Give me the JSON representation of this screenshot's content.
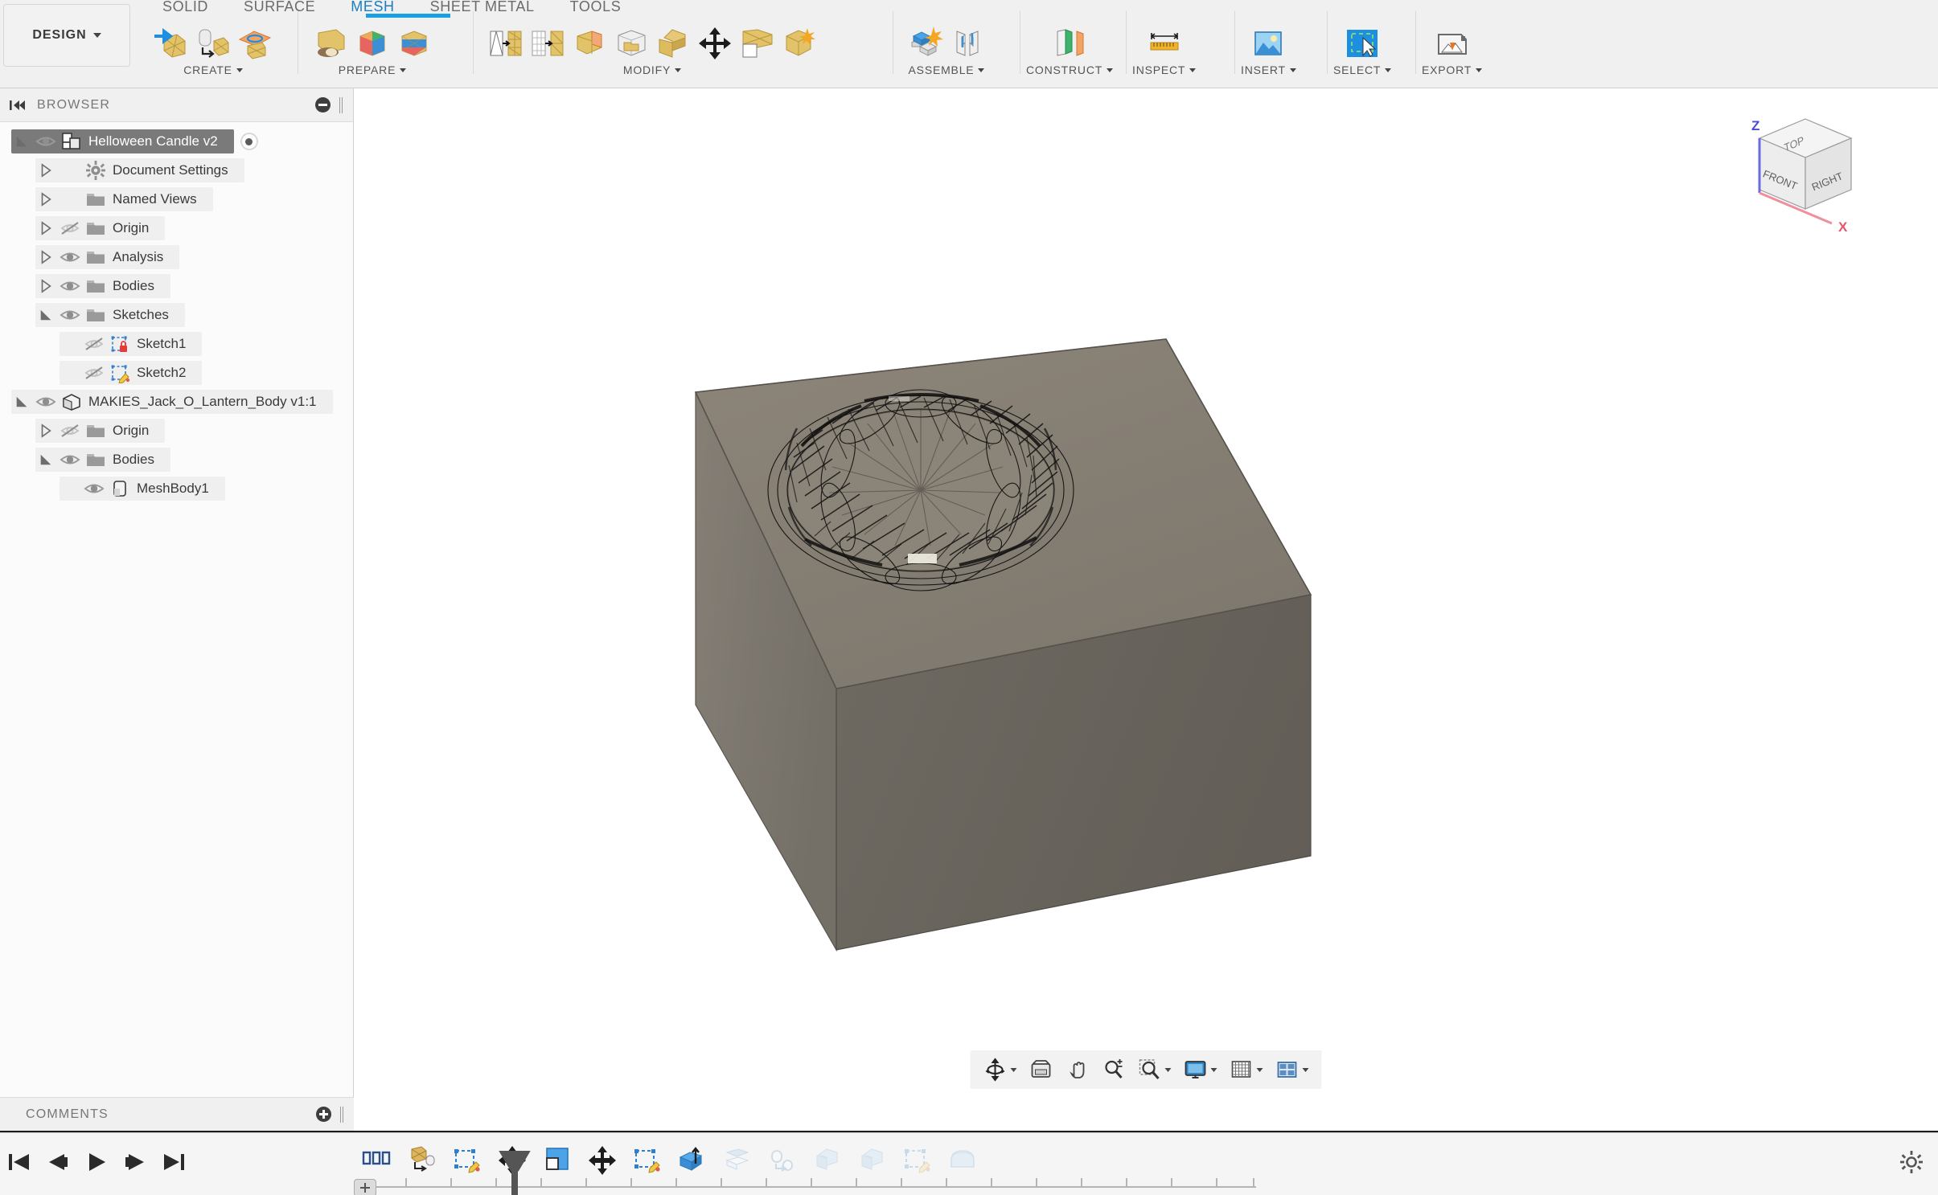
{
  "app": {
    "workspace_button": "DESIGN",
    "accent_color": "#1aa0e0",
    "selection_color": "#7a7a7a"
  },
  "ribbon": {
    "tabs": [
      {
        "label": "SOLID",
        "active": false
      },
      {
        "label": "SURFACE",
        "active": false
      },
      {
        "label": "MESH",
        "active": true
      },
      {
        "label": "SHEET METAL",
        "active": false
      },
      {
        "label": "TOOLS",
        "active": false
      }
    ],
    "groups": [
      {
        "label": "CREATE",
        "has_dropdown": true,
        "tools": [
          "create-mesh-icon",
          "mesh-from-bodies-icon",
          "mesh-section-sketch-icon"
        ]
      },
      {
        "label": "PREPARE",
        "has_dropdown": true,
        "tools": [
          "generate-face-groups-icon",
          "segment-mesh-icon",
          "split-face-icon"
        ]
      },
      {
        "label": "MODIFY",
        "has_dropdown": true,
        "tools": [
          "remesh-icon",
          "reduce-icon",
          "make-closed-mesh-icon",
          "erase-and-fill-icon",
          "smooth-icon",
          "move-copy-icon",
          "delete-faces-icon",
          "direct-edit-icon"
        ]
      },
      {
        "label": "ASSEMBLE",
        "has_dropdown": true,
        "tools": [
          "new-component-icon",
          "joint-icon"
        ]
      },
      {
        "label": "CONSTRUCT",
        "has_dropdown": true,
        "tools": [
          "offset-plane-icon"
        ]
      },
      {
        "label": "INSPECT",
        "has_dropdown": true,
        "tools": [
          "measure-icon"
        ]
      },
      {
        "label": "INSERT",
        "has_dropdown": true,
        "tools": [
          "insert-image-icon"
        ]
      },
      {
        "label": "SELECT",
        "has_dropdown": true,
        "tools": [
          "select-window-icon"
        ]
      },
      {
        "label": "EXPORT",
        "has_dropdown": true,
        "tools": [
          "export-mesh-icon"
        ]
      }
    ]
  },
  "browser": {
    "title": "BROWSER",
    "collapse_icon": "collapse-panel-icon",
    "minus_icon": "minus-circle-icon",
    "tree": [
      {
        "label": "Helloween Candle v2",
        "indent": 0,
        "twist": "open",
        "eye": "visible",
        "icon": "component-icon",
        "selected": true,
        "badge": true
      },
      {
        "label": "Document Settings",
        "indent": 1,
        "twist": "closed",
        "eye": "none",
        "icon": "gear-icon",
        "selected": false,
        "badge": false
      },
      {
        "label": "Named Views",
        "indent": 1,
        "twist": "closed",
        "eye": "none",
        "icon": "folder-icon",
        "selected": false,
        "badge": false
      },
      {
        "label": "Origin",
        "indent": 1,
        "twist": "closed",
        "eye": "hidden",
        "icon": "folder-icon",
        "selected": false,
        "badge": false
      },
      {
        "label": "Analysis",
        "indent": 1,
        "twist": "closed",
        "eye": "visible",
        "icon": "folder-icon",
        "selected": false,
        "badge": false
      },
      {
        "label": "Bodies",
        "indent": 1,
        "twist": "closed",
        "eye": "visible",
        "icon": "folder-icon",
        "selected": false,
        "badge": false
      },
      {
        "label": "Sketches",
        "indent": 1,
        "twist": "open",
        "eye": "visible",
        "icon": "folder-icon",
        "selected": false,
        "badge": false
      },
      {
        "label": "Sketch1",
        "indent": 2,
        "twist": "none",
        "eye": "hidden",
        "icon": "sketch-locked-icon",
        "selected": false,
        "badge": false
      },
      {
        "label": "Sketch2",
        "indent": 2,
        "twist": "none",
        "eye": "hidden",
        "icon": "sketch-edit-icon",
        "selected": false,
        "badge": false
      },
      {
        "label": "MAKIES_Jack_O_Lantern_Body v1:1",
        "indent": 0,
        "twist": "open",
        "eye": "visible",
        "icon": "body-icon",
        "selected": false,
        "badge": false
      },
      {
        "label": "Origin",
        "indent": 1,
        "twist": "closed",
        "eye": "hidden",
        "icon": "folder-icon",
        "selected": false,
        "badge": false
      },
      {
        "label": "Bodies",
        "indent": 1,
        "twist": "open",
        "eye": "visible",
        "icon": "folder-icon",
        "selected": false,
        "badge": false
      },
      {
        "label": "MeshBody1",
        "indent": 2,
        "twist": "none",
        "eye": "visible",
        "icon": "mesh-body-icon",
        "selected": false,
        "badge": false
      }
    ]
  },
  "comments": {
    "title": "COMMENTS",
    "add_icon": "plus-circle-icon"
  },
  "canvas": {
    "model_name": "Helloween Candle box with scalloped mesh opening",
    "body_fill_top": "#8a8378",
    "body_fill_left": "#7d776e",
    "body_fill_right": "#6f6a62",
    "mesh_wire_color": "#141414",
    "viewcube": {
      "faces": [
        "TOP",
        "FRONT",
        "RIGHT"
      ],
      "axes": [
        {
          "label": "Z",
          "color": "#5b5bdd"
        },
        {
          "label": "X",
          "color": "#e8687a"
        }
      ]
    }
  },
  "navbar": {
    "items": [
      {
        "name": "orbit-icon",
        "dropdown": true
      },
      {
        "name": "look-at-icon",
        "dropdown": false
      },
      {
        "name": "pan-icon",
        "dropdown": false
      },
      {
        "name": "zoom-icon",
        "dropdown": false
      },
      {
        "name": "zoom-window-icon",
        "dropdown": true
      },
      {
        "name": "display-settings-icon",
        "dropdown": true
      },
      {
        "name": "grid-snap-icon",
        "dropdown": true
      },
      {
        "name": "viewports-icon",
        "dropdown": true
      }
    ]
  },
  "timeline": {
    "playback": [
      {
        "name": "go-to-beginning-icon"
      },
      {
        "name": "step-back-icon"
      },
      {
        "name": "play-icon"
      },
      {
        "name": "step-forward-icon"
      },
      {
        "name": "go-to-end-icon"
      }
    ],
    "features": [
      {
        "name": "document-settings-feature-icon",
        "dimmed": false
      },
      {
        "name": "insert-mesh-feature-icon",
        "dimmed": false
      },
      {
        "name": "sketch-feature-icon",
        "dimmed": false
      },
      {
        "name": "move-feature-icon",
        "dimmed": false
      },
      {
        "name": "box-feature-icon",
        "dimmed": false
      },
      {
        "name": "move-feature-icon",
        "dimmed": false
      },
      {
        "name": "sketch-feature-icon",
        "dimmed": false
      },
      {
        "name": "extrude-feature-icon",
        "dimmed": false
      },
      {
        "name": "offset-feature-icon",
        "dimmed": true
      },
      {
        "name": "shell-feature-icon",
        "dimmed": true
      },
      {
        "name": "combine-feature-icon",
        "dimmed": true
      },
      {
        "name": "combine-feature-icon",
        "dimmed": true
      },
      {
        "name": "sketch-feature-icon",
        "dimmed": true
      },
      {
        "name": "fillet-feature-icon",
        "dimmed": true
      }
    ],
    "settings_icon": "gear-icon",
    "add_marker_icon": "timeline-marker-icon"
  }
}
